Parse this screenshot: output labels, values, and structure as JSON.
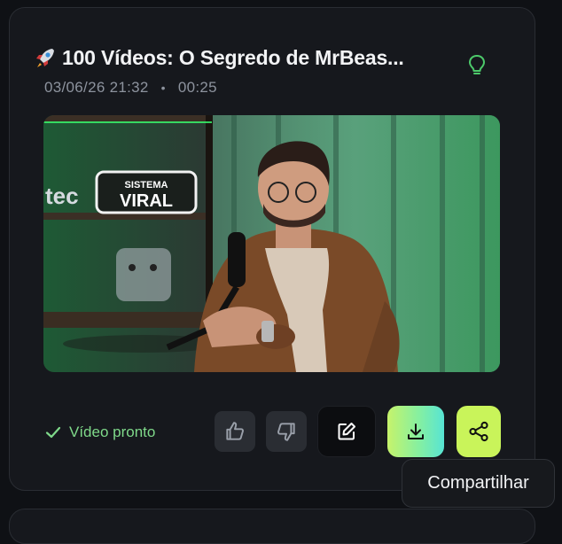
{
  "card": {
    "title": "100 Vídeos: O Segredo de MrBeas...",
    "title_emoji_icon": "rocket-icon",
    "date": "03/06/26 21:32",
    "separator": "•",
    "duration": "00:25",
    "hint_icon": "lightbulb-icon"
  },
  "video": {
    "neon_sign_line1": "SISTEMA",
    "neon_sign_line2": "VIRAL",
    "wall_text": "tec"
  },
  "status": {
    "icon": "check-icon",
    "label": "Vídeo pronto"
  },
  "actions": {
    "like_icon": "thumbs-up-icon",
    "dislike_icon": "thumbs-down-icon",
    "edit_icon": "edit-icon",
    "download_icon": "download-icon",
    "share_icon": "share-icon"
  },
  "tooltip": {
    "text": "Compartilhar"
  },
  "colors": {
    "accent_green": "#c9f45a",
    "status_green": "#7fd98a",
    "bulb_green": "#4cc96a"
  }
}
